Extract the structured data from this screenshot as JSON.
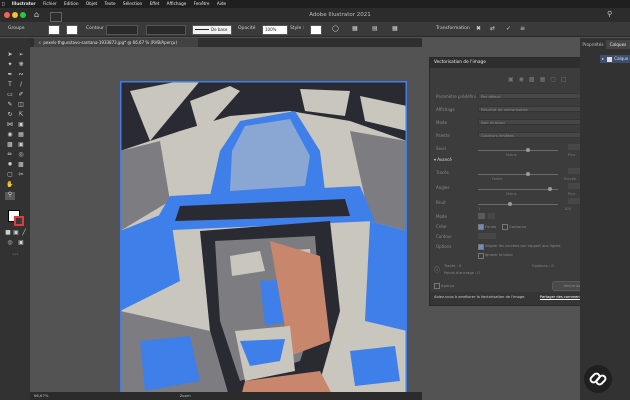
{
  "menubar": {
    "items": [
      "Illustrator",
      "Fichier",
      "Edition",
      "Objet",
      "Texte",
      "Sélection",
      "Effet",
      "Affichage",
      "Fenêtre",
      "Aide"
    ]
  },
  "titlebar": {
    "title": "Adobe Illustrator 2021"
  },
  "controlbar": {
    "selection_label": "Groupe",
    "stroke_label": "Contour :",
    "brush_label": "De base",
    "opacity_label": "Opacité",
    "opacity_value": "100%",
    "style_label": "Style :",
    "transform_label": "Transformation"
  },
  "document": {
    "tab_label": "pexels-thgusstavo-santana-1933873.jpg* @ 66,67 % (RVB/Aperçu)"
  },
  "trace_panel": {
    "title": "Vectorisation de l'image",
    "preset_label": "Paramètre prédéfini",
    "preset_value": "Par défaut",
    "view_label": "Affichage",
    "view_value": "Résultat de vectorisation",
    "mode_label": "Mode",
    "mode_value": "Noir et blanc",
    "palette_label": "Palette",
    "palette_value": "Couleurs limitées",
    "threshold_label": "Seuil",
    "less_label": "Moins",
    "more_label": "Plus",
    "advanced_label": "Avancé",
    "paths_label": "Tracés",
    "loose_label": "Faible",
    "tight_label": "Elevée",
    "corners_label": "Angles",
    "noise_label": "Bruit",
    "noise_min": "1",
    "noise_max": "100",
    "method_label": "Mode",
    "create_label": "Créer",
    "fills_label": "Fonds",
    "strokes_label": "Contours",
    "stroke_width_label": "Contour",
    "options_label": "Options",
    "snap_curves_label": "Aligner les courbes par rapport aux lignes",
    "ignore_white_label": "Ignorer le blanc",
    "paths_count_label": "Tracés : 0",
    "anchors_count_label": "Points d'ancrage : 0",
    "colors_count_label": "Couleurs : 0",
    "preview_label": "Aperçu",
    "trace_button": "Vectoriser",
    "feedback_label": "Aidez-nous à améliorer la Vectorisation de l'image.",
    "feedback_link": "Partager des commentaires."
  },
  "right_panels": {
    "properties_tab": "Propriétés",
    "layers_tab": "Calques",
    "layer_name": "Calque"
  },
  "statusbar": {
    "zoom": "66,67%",
    "mode": "Zoom"
  },
  "colors": {
    "blue": "#3f7fea",
    "gray_light": "#c9c6bd",
    "dark": "#2a2a33",
    "mid_gray": "#7d7c80",
    "skin": "#c8866c"
  }
}
